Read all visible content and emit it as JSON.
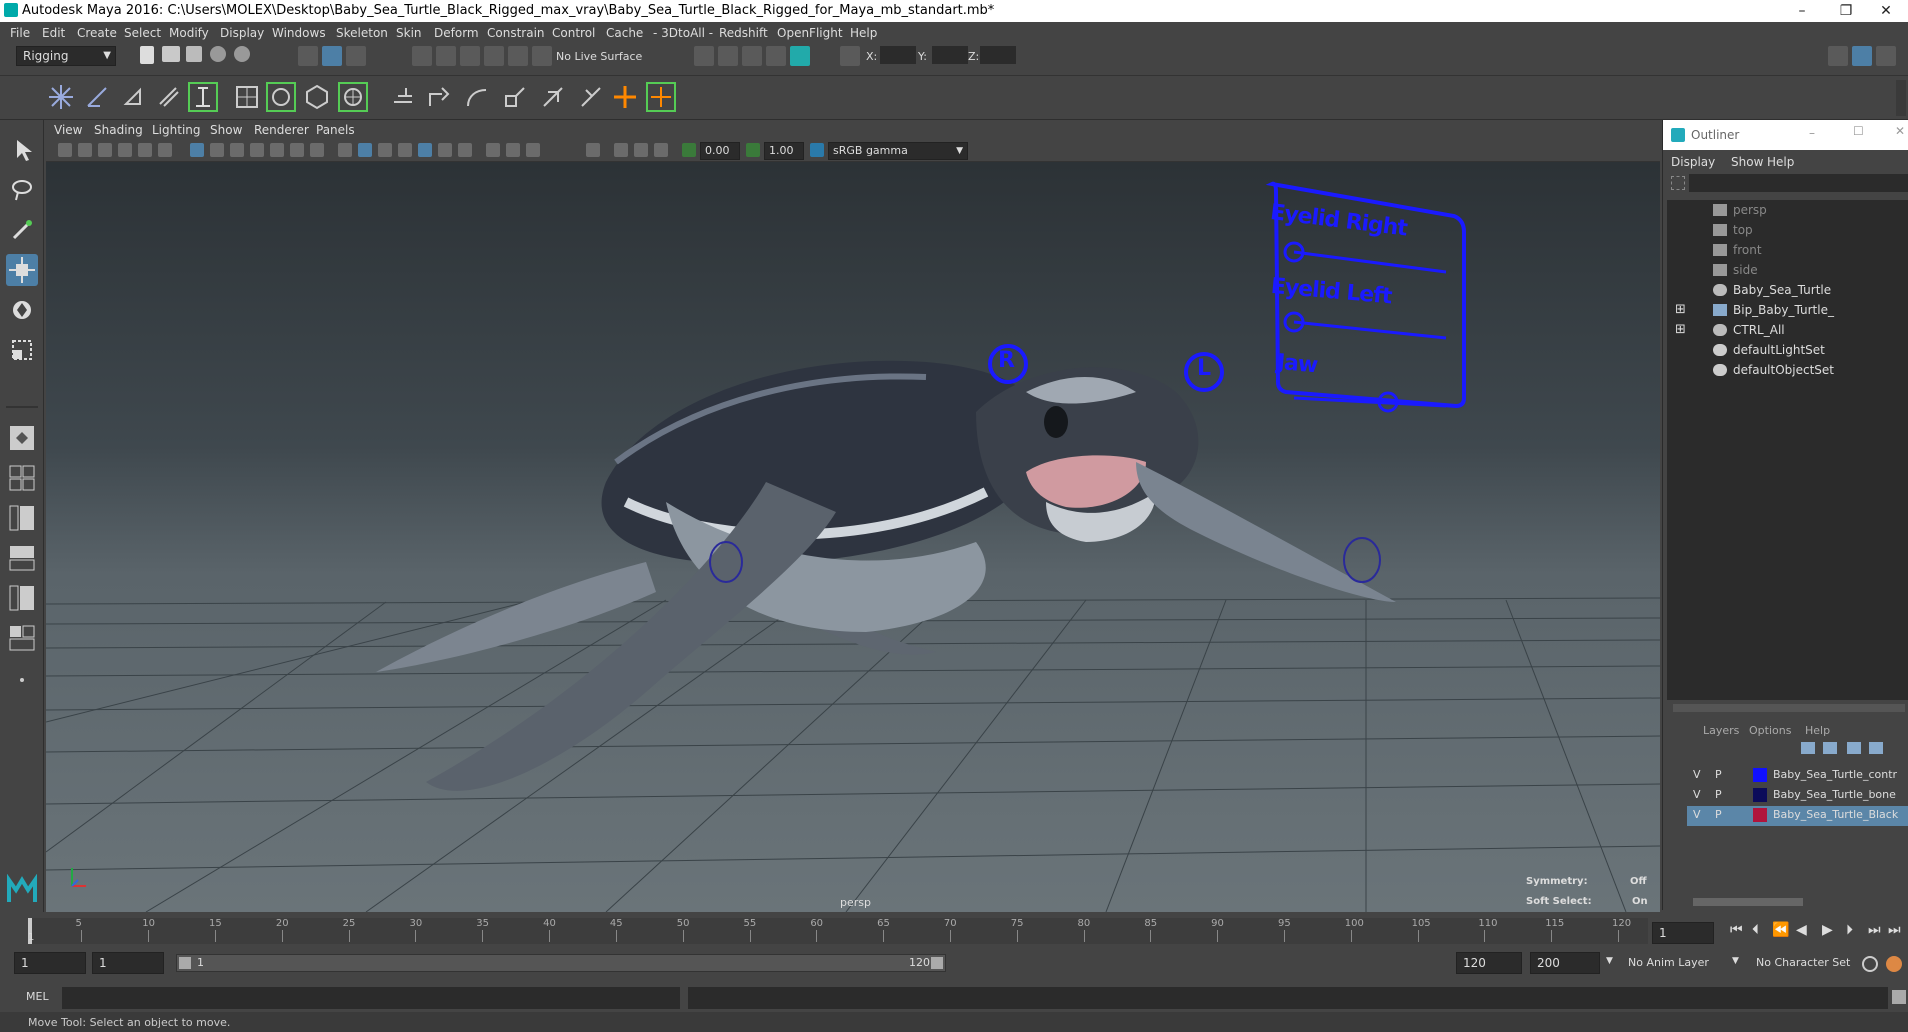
{
  "window": {
    "title": "Autodesk Maya 2016: C:\\Users\\MOLEX\\Desktop\\Baby_Sea_Turtle_Black_Rigged_max_vray\\Baby_Sea_Turtle_Black_Rigged_for_Maya_mb_standart.mb*",
    "minimize": "–",
    "restore": "❐",
    "close": "✕"
  },
  "menubar": [
    "File",
    "Edit",
    "Create",
    "Select",
    "Modify",
    "Display",
    "Windows",
    "Skeleton",
    "Skin",
    "Deform",
    "Constrain",
    "Control",
    "Cache",
    "- 3DtoAll -",
    "Redshift",
    "OpenFlight",
    "Help"
  ],
  "statusline": {
    "menuset": "Rigging",
    "live_surface": "No Live Surface",
    "x_label": "X:",
    "y_label": "Y:",
    "z_label": "Z:"
  },
  "viewport": {
    "menus": [
      "View",
      "Shading",
      "Lighting",
      "Show",
      "Renderer",
      "Panels"
    ],
    "near_value": "0.00",
    "far_value": "1.00",
    "color_space": "sRGB gamma",
    "camera_label": "persp",
    "symmetry_label": "Symmetry:",
    "symmetry_value": "Off",
    "soft_select_label": "Soft Select:",
    "soft_select_value": "On",
    "panel": {
      "eyelid_right": "Eyelid Right",
      "eyelid_left": "Eyelid Left",
      "jaw": "Jaw"
    },
    "eye_r_ctrl": "R",
    "eye_l_ctrl": "L"
  },
  "outliner": {
    "title": "Outliner",
    "menus": [
      "Display",
      "Show",
      "Help"
    ],
    "items": [
      {
        "label": "persp",
        "icon": "camera-icon",
        "dim": true,
        "expand": false
      },
      {
        "label": "top",
        "icon": "camera-icon",
        "dim": true,
        "expand": false
      },
      {
        "label": "front",
        "icon": "camera-icon",
        "dim": true,
        "expand": false
      },
      {
        "label": "side",
        "icon": "camera-icon",
        "dim": true,
        "expand": false
      },
      {
        "label": "Baby_Sea_Turtle",
        "icon": "transform-icon",
        "dim": false,
        "expand": false
      },
      {
        "label": "Bip_Baby_Turtle_",
        "icon": "joint-icon",
        "dim": false,
        "expand": true
      },
      {
        "label": "CTRL_All",
        "icon": "transform-icon",
        "dim": false,
        "expand": true
      },
      {
        "label": "defaultLightSet",
        "icon": "set-icon",
        "dim": false,
        "expand": false
      },
      {
        "label": "defaultObjectSet",
        "icon": "set-icon",
        "dim": false,
        "expand": false
      }
    ]
  },
  "layers": {
    "menus": [
      "Layers",
      "Options",
      "Help"
    ],
    "rows": [
      {
        "v": "V",
        "p": "P",
        "color": "#1010ff",
        "name": "Baby_Sea_Turtle_contr",
        "selected": false
      },
      {
        "v": "V",
        "p": "P",
        "color": "#0c0c5a",
        "name": "Baby_Sea_Turtle_bone",
        "selected": false
      },
      {
        "v": "V",
        "p": "P",
        "color": "#b0143c",
        "name": "Baby_Sea_Turtle_Black",
        "selected": true
      }
    ]
  },
  "timeline": {
    "ticks": [
      "5",
      "10",
      "15",
      "20",
      "25",
      "30",
      "35",
      "40",
      "45",
      "50",
      "55",
      "60",
      "65",
      "70",
      "75",
      "80",
      "85",
      "90",
      "95",
      "100",
      "105",
      "110",
      "115",
      "120"
    ],
    "start_tick": "1",
    "current_frame": "1"
  },
  "range": {
    "start": "1",
    "playback_start": "1",
    "slider_start": "1",
    "slider_end": "120",
    "playback_end": "120",
    "end": "200",
    "anim_layer": "No Anim Layer",
    "character_set": "No Character Set"
  },
  "cmdline": {
    "mode": "MEL"
  },
  "help_line": "Move Tool: Select an object to move."
}
